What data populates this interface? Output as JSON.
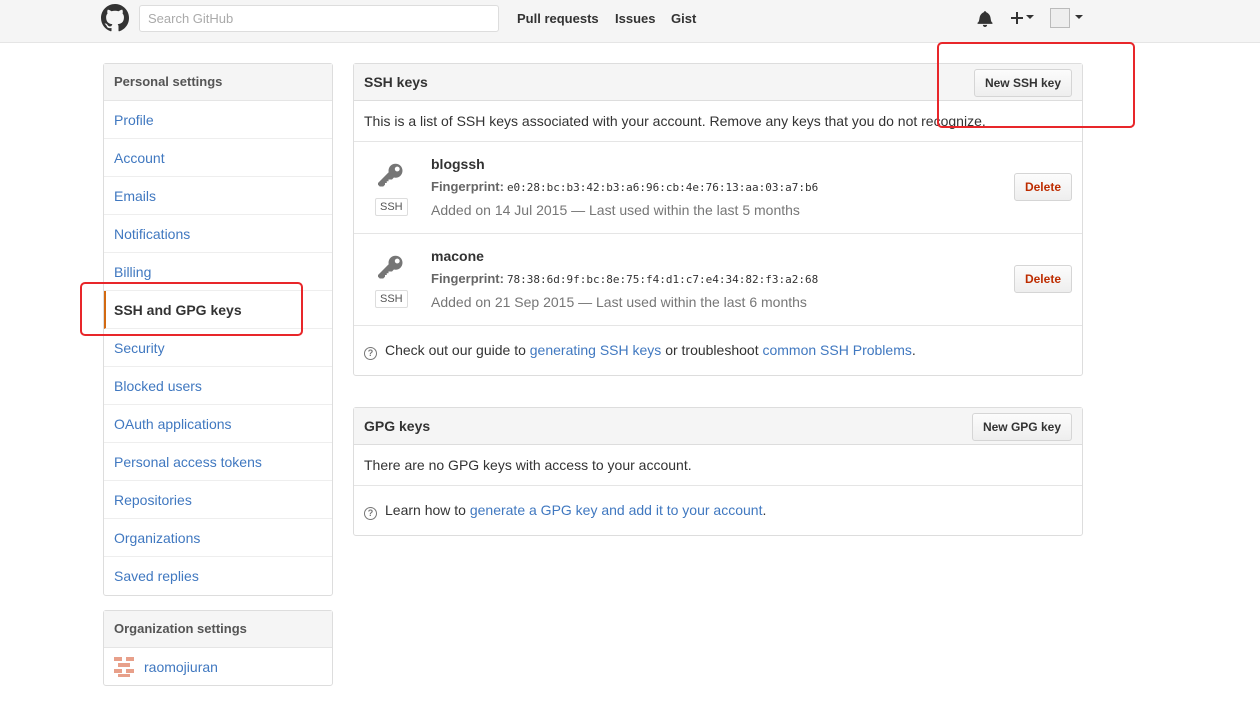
{
  "header": {
    "search_placeholder": "Search GitHub",
    "nav": [
      "Pull requests",
      "Issues",
      "Gist"
    ]
  },
  "sidebar": {
    "personal_heading": "Personal settings",
    "items": [
      {
        "label": "Profile"
      },
      {
        "label": "Account"
      },
      {
        "label": "Emails"
      },
      {
        "label": "Notifications"
      },
      {
        "label": "Billing"
      },
      {
        "label": "SSH and GPG keys",
        "selected": true
      },
      {
        "label": "Security"
      },
      {
        "label": "Blocked users"
      },
      {
        "label": "OAuth applications"
      },
      {
        "label": "Personal access tokens"
      },
      {
        "label": "Repositories"
      },
      {
        "label": "Organizations"
      },
      {
        "label": "Saved replies"
      }
    ],
    "org_heading": "Organization settings",
    "org": {
      "name": "raomojiuran"
    }
  },
  "ssh": {
    "title": "SSH keys",
    "new_button": "New SSH key",
    "description": "This is a list of SSH keys associated with your account. Remove any keys that you do not recognize.",
    "badge": "SSH",
    "fingerprint_label": "Fingerprint:",
    "delete_label": "Delete",
    "keys": [
      {
        "title": "blogssh",
        "fingerprint": "e0:28:bc:b3:42:b3:a6:96:cb:4e:76:13:aa:03:a7:b6",
        "added": "Added on 14 Jul 2015 — Last used within the last 5 months"
      },
      {
        "title": "macone",
        "fingerprint": "78:38:6d:9f:bc:8e:75:f4:d1:c7:e4:34:82:f3:a2:68",
        "added": "Added on 21 Sep 2015 — Last used within the last 6 months"
      }
    ],
    "help_prefix": "Check out our guide to",
    "help_link1": "generating SSH keys",
    "help_middle": "or troubleshoot",
    "help_link2": "common SSH Problems",
    "help_suffix": "."
  },
  "gpg": {
    "title": "GPG keys",
    "new_button": "New GPG key",
    "empty_text": "There are no GPG keys with access to your account.",
    "help_prefix": "Learn how to",
    "help_link": "generate a GPG key and add it to your account",
    "help_suffix": "."
  },
  "colors": {
    "link": "#4078c0",
    "selected_accent": "#d26911",
    "danger": "#bd2c00",
    "annotation": "#e8262a"
  },
  "icons": {
    "logo": "github-mark-icon",
    "bell": "bell-icon",
    "plus": "plus-icon",
    "key": "key-icon",
    "help": "question-circle-icon"
  }
}
